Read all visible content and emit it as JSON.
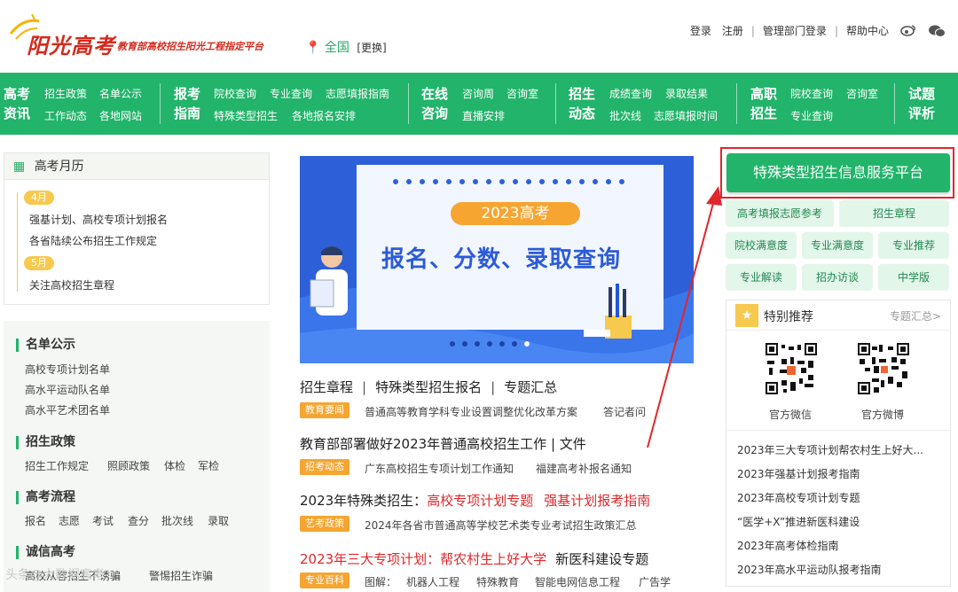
{
  "header": {
    "logo_main": "阳光高考",
    "logo_sub": "教育部高校招生阳光工程指定平台",
    "location": "全国",
    "location_switch": "[更换]",
    "login": "登录",
    "register": "注册",
    "admin_login": "管理部门登录",
    "help": "帮助中心"
  },
  "nav": {
    "groups": [
      {
        "head": "高考资讯",
        "links": [
          "招生政策",
          "名单公示",
          "工作动态",
          "各地网站"
        ]
      },
      {
        "head": "报考指南",
        "links": [
          "院校查询",
          "专业查询",
          "志愿填报指南",
          "特殊类型招生",
          "各地报名安排"
        ]
      },
      {
        "head": "在线咨询",
        "links": [
          "咨询周",
          "咨询室",
          "直播安排"
        ]
      },
      {
        "head": "招生动态",
        "links": [
          "成绩查询",
          "录取结果",
          "批次线",
          "志愿填报时间"
        ]
      },
      {
        "head": "高职招生",
        "links": [
          "院校查询",
          "咨询室",
          "专业查询"
        ]
      },
      {
        "head": "试题评析",
        "links": []
      }
    ]
  },
  "calendar": {
    "title": "高考月历",
    "months": [
      {
        "label": "4月",
        "items": [
          "强基计划、高校专项计划报名",
          "各省陆续公布招生工作规定"
        ]
      },
      {
        "label": "5月",
        "items": [
          "关注高校招生章程"
        ]
      }
    ]
  },
  "left_sections": [
    {
      "title": "名单公示",
      "links": [
        "高校专项计划名单",
        "高水平运动队名单",
        "高水平艺术团名单"
      ]
    },
    {
      "title": "招生政策",
      "links": [
        "招生工作规定",
        "照顾政策",
        "体检",
        "军检"
      ]
    },
    {
      "title": "高考流程",
      "links": [
        "报名",
        "志愿",
        "考试",
        "查分",
        "批次线",
        "录取"
      ]
    },
    {
      "title": "诚信高考",
      "links": [
        "高校从容招生不诱骗",
        "警惕招生诈骗"
      ]
    }
  ],
  "banner": {
    "tag": "2023高考",
    "headline": "报名、分数、录取查询"
  },
  "main": {
    "row1": [
      "招生章程",
      "特殊类型招生报名",
      "专题汇总"
    ],
    "row1_sep": "|",
    "tag1": "教育要闻",
    "tag1_links": [
      "普通高等教育学科专业设置调整优化改革方案",
      "答记者问"
    ],
    "row2": "教育部部署做好2023年普通高校招生工作 | 文件",
    "tag2": "招考动态",
    "tag2_links": [
      "广东高校招生专项计划工作通知",
      "福建高考补报名通知"
    ],
    "row3_prefix": "2023年特殊类招生：",
    "row3_links": [
      "高校专项计划专题",
      "强基计划报考指南"
    ],
    "tag3": "艺考政策",
    "tag3_links": [
      "2024年各省市普通高等学校艺术类专业考试招生政策汇总"
    ],
    "row4_red": "2023年三大专项计划：帮农村生上好大学",
    "row4_black": "新医科建设专题",
    "tag4": "专业百科",
    "tag4_prefix": "图解：",
    "tag4_links": [
      "机器人工程",
      "特殊教育",
      "智能电网信息工程",
      "广告学"
    ]
  },
  "right": {
    "main_button": "特殊类型招生信息服务平台",
    "buttons": [
      "高考填报志愿参考",
      "招生章程",
      "院校满意度",
      "专业满意度",
      "专业推荐",
      "专业解读",
      "招办访谈",
      "中学版"
    ],
    "rec_title": "特别推荐",
    "rec_more": "专题汇总>",
    "qr_labels": [
      "官方微信",
      "官方微博"
    ],
    "rec_links": [
      "2023年三大专项计划帮农村生上好大...",
      "2023年强基计划报考指南",
      "2023年高校专项计划专题",
      "“医学+X”推进新医科建设",
      "2023年高考体检指南",
      "2023年高水平运动队报考指南"
    ]
  },
  "watermark": "头条@大数据高考",
  "colors": {
    "brand_green": "#21b46a",
    "accent_red": "#e0272b",
    "tag_orange": "#f6a531"
  }
}
